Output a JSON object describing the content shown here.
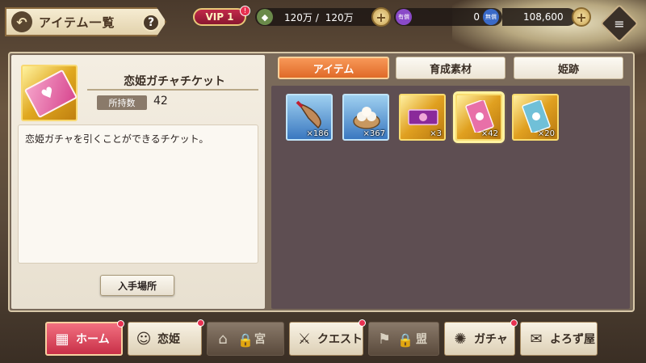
{
  "header": {
    "title": "アイテム一覧",
    "help": "?",
    "back_arrow": "↶",
    "vip_label": "VIP 1",
    "vip_badge": "!",
    "stamina": "120万 /",
    "stamina_max": "120万",
    "gems_icon_label": "有償",
    "gems": "0",
    "free_gems_icon_label": "無償",
    "free_gems": "108,600",
    "menu_icon": "≡"
  },
  "detail": {
    "item_name": "恋姫ガチャチケット",
    "owned_label": "所持数",
    "owned_value": "42",
    "description": "恋姫ガチャを引くことができるチケット。",
    "source_button": "入手場所"
  },
  "tabs": [
    {
      "label": "アイテム",
      "active": true
    },
    {
      "label": "育成素材",
      "active": false
    },
    {
      "label": "姫跡",
      "active": false
    }
  ],
  "items": [
    {
      "icon": "conch-horn-icon",
      "count": "×186",
      "frame": "blue"
    },
    {
      "icon": "steamer-buns-icon",
      "count": "×367",
      "frame": "blue"
    },
    {
      "icon": "purple-ticket-icon",
      "count": "×3",
      "frame": "gold"
    },
    {
      "icon": "pink-ticket-icon",
      "count": "×42",
      "frame": "gold",
      "selected": true
    },
    {
      "icon": "blue-ticket-icon",
      "count": "×20",
      "frame": "gold"
    }
  ],
  "nav": {
    "home": "ホーム",
    "heroines": "恋姫",
    "palace": "宮",
    "quest": "クエスト",
    "alliance": "盟",
    "gacha": "ガチャ",
    "shop": "よろず屋"
  },
  "colors": {
    "accent": "#e06a28",
    "panel": "#5e4e52",
    "badge": "#e83050"
  }
}
